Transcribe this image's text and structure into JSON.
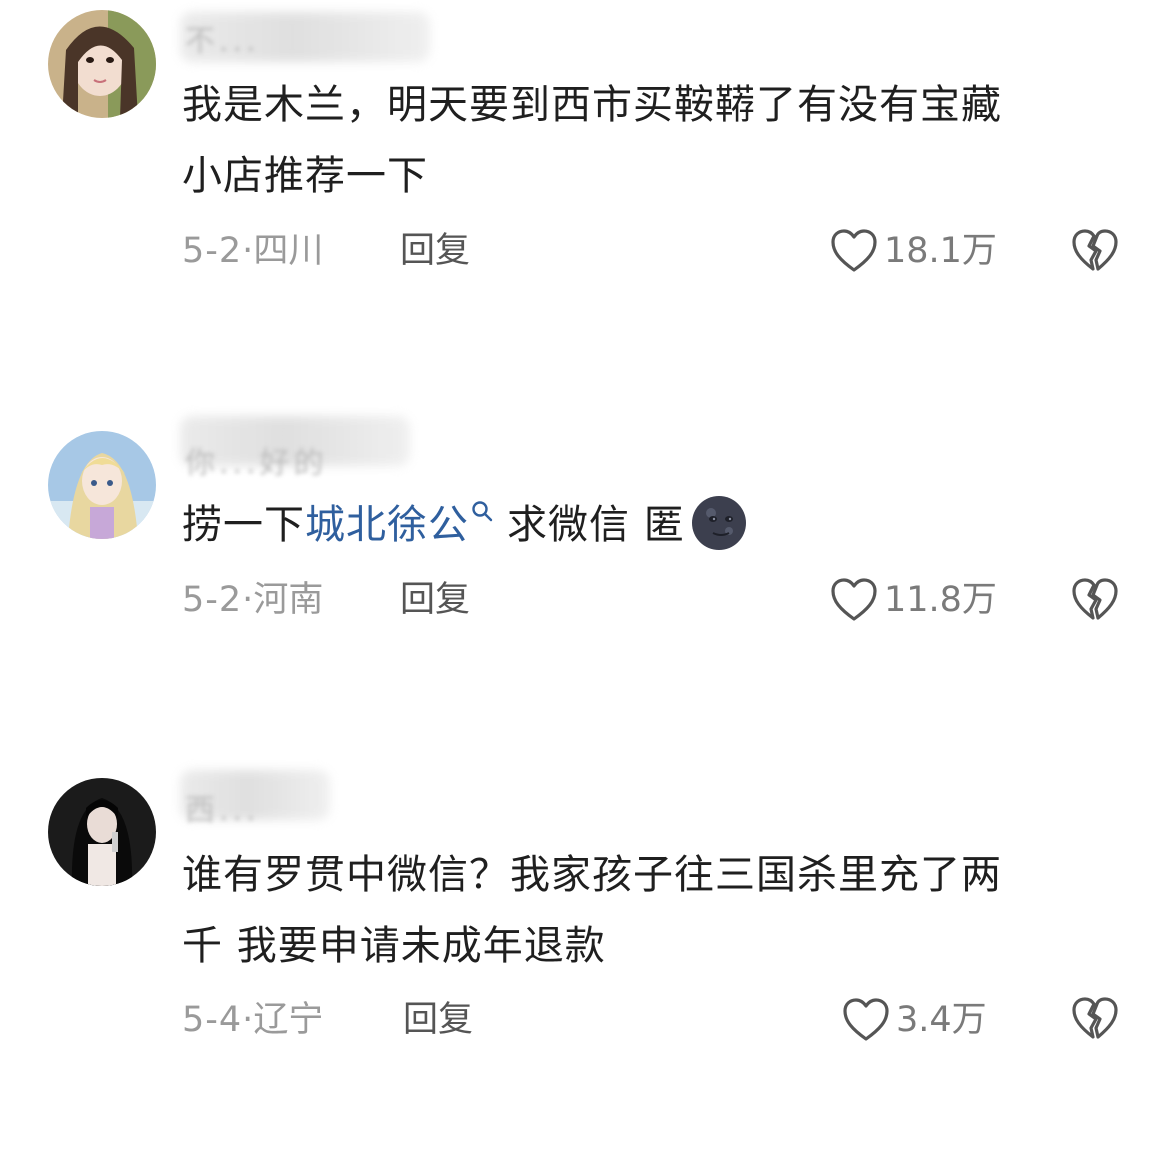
{
  "comments": [
    {
      "username": "不...",
      "text_lines": [
        "我是木兰，明天要到西市买鞍鞯了有没有宝藏",
        "小店推荐一下"
      ],
      "date": "5-2",
      "location": "四川",
      "reply_label": "回复",
      "likes": "18.1万"
    },
    {
      "username": "你...好的",
      "text_prefix": "捞一下",
      "mention": "城北徐公",
      "text_suffix": "求微信 匿",
      "emoji": "new-moon-face-emoji",
      "date": "5-2",
      "location": "河南",
      "reply_label": "回复",
      "likes": "11.8万"
    },
    {
      "username": "西...",
      "text_lines": [
        "谁有罗贯中微信？我家孩子往三国杀里充了两",
        "千 我要申请未成年退款"
      ],
      "date": "5-4",
      "location": "辽宁",
      "reply_label": "回复",
      "likes": "3.4万"
    }
  ],
  "date_separator": "·",
  "colors": {
    "mention": "#2f5f9e",
    "meta": "#9a9a9a",
    "text": "#1f1f1f"
  },
  "icons": {
    "like": "heart-outline-icon",
    "dislike": "broken-heart-icon",
    "search": "search-icon"
  }
}
